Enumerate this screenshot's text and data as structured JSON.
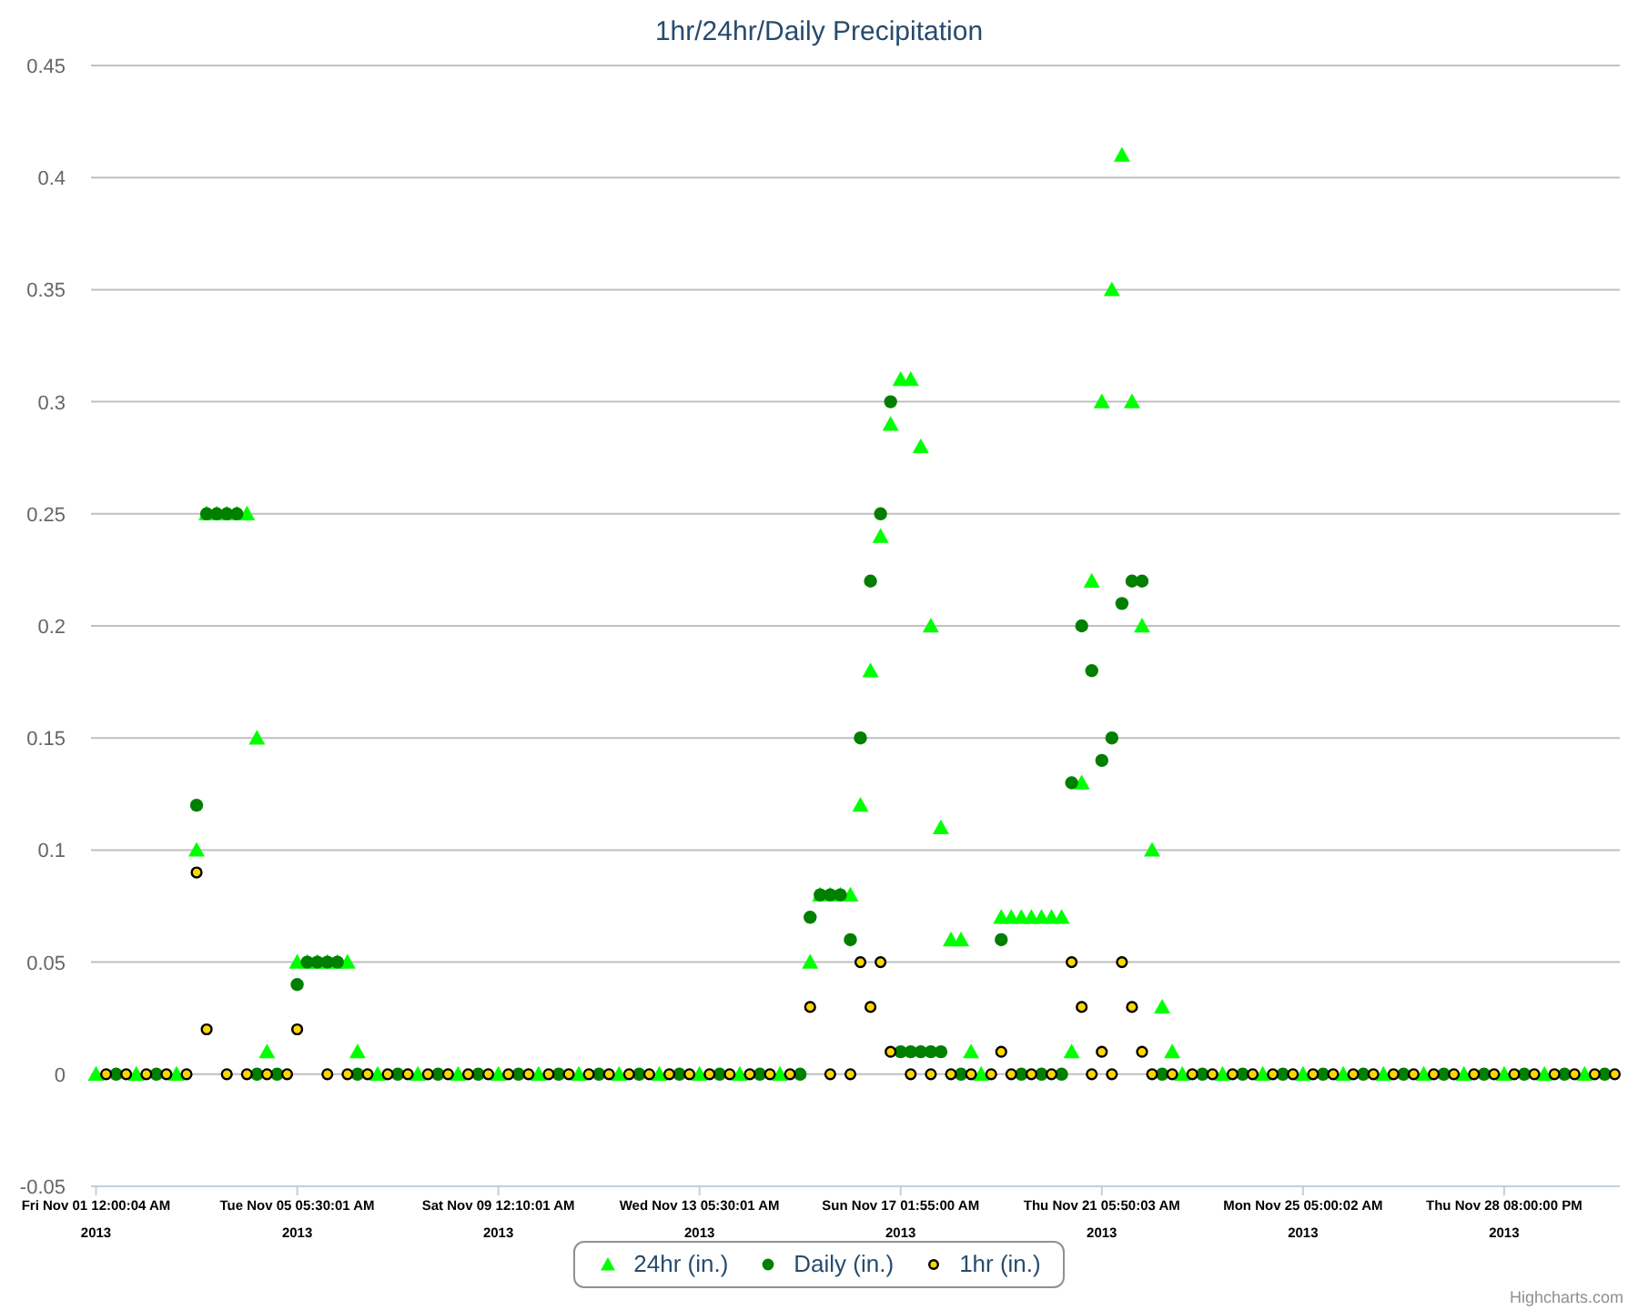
{
  "chart": {
    "chart_data": {
      "type": "scatter",
      "title": "1hr/24hr/Daily Precipitation",
      "grid": true,
      "ylim": [
        -0.05,
        0.45
      ],
      "yticks": [
        -0.05,
        0,
        0.05,
        0.1,
        0.15,
        0.2,
        0.25,
        0.3,
        0.35,
        0.4,
        0.45
      ],
      "categories": [
        "Fri Nov 01 12:00:04 AM\n2013",
        null,
        null,
        null,
        null,
        null,
        null,
        null,
        null,
        null,
        null,
        null,
        null,
        null,
        null,
        null,
        null,
        null,
        null,
        null,
        "Tue Nov 05 05:30:01 AM\n2013",
        null,
        null,
        null,
        null,
        null,
        null,
        null,
        null,
        null,
        null,
        null,
        null,
        null,
        null,
        null,
        null,
        null,
        null,
        null,
        "Sat Nov 09 12:10:01 AM\n2013",
        null,
        null,
        null,
        null,
        null,
        null,
        null,
        null,
        null,
        null,
        null,
        null,
        null,
        null,
        null,
        null,
        null,
        null,
        null,
        "Wed Nov 13 05:30:01 AM\n2013",
        null,
        null,
        null,
        null,
        null,
        null,
        null,
        null,
        null,
        null,
        null,
        null,
        null,
        null,
        null,
        null,
        null,
        null,
        null,
        "Sun Nov 17 01:55:00 AM\n2013",
        null,
        null,
        null,
        null,
        null,
        null,
        null,
        null,
        null,
        null,
        null,
        null,
        null,
        null,
        null,
        null,
        null,
        null,
        null,
        "Thu Nov 21 05:50:03 AM\n2013",
        null,
        null,
        null,
        null,
        null,
        null,
        null,
        null,
        null,
        null,
        null,
        null,
        null,
        null,
        null,
        null,
        null,
        null,
        null,
        "Mon Nov 25 05:00:02 AM\n2013",
        null,
        null,
        null,
        null,
        null,
        null,
        null,
        null,
        null,
        null,
        null,
        null,
        null,
        null,
        null,
        null,
        null,
        null,
        null,
        "Thu Nov 28 08:00:00 PM\n2013",
        null,
        null,
        null,
        null,
        null,
        null,
        null,
        null,
        null,
        null,
        null
      ],
      "series": [
        {
          "name": "24hr (in.)",
          "color": "#00ff00",
          "marker": "triangle",
          "values": [
            0,
            null,
            null,
            null,
            0,
            null,
            null,
            null,
            0,
            null,
            0.1,
            0.25,
            0.25,
            0.25,
            0.25,
            0.25,
            0.15,
            0.01,
            null,
            null,
            0.05,
            0.05,
            0.05,
            0.05,
            0.05,
            0.05,
            0.01,
            null,
            0,
            null,
            null,
            null,
            0,
            null,
            null,
            null,
            0,
            null,
            null,
            null,
            0,
            null,
            null,
            null,
            0,
            null,
            null,
            null,
            0,
            null,
            null,
            null,
            0,
            null,
            null,
            null,
            0,
            null,
            null,
            null,
            0,
            null,
            null,
            null,
            0,
            null,
            null,
            null,
            0,
            null,
            null,
            0.05,
            0.08,
            0.08,
            0.08,
            0.08,
            0.12,
            0.18,
            0.24,
            0.29,
            0.31,
            0.31,
            0.28,
            0.2,
            0.11,
            0.06,
            0.06,
            0.01,
            0,
            null,
            0.07,
            0.07,
            0.07,
            0.07,
            0.07,
            0.07,
            0.07,
            0.01,
            0.13,
            0.22,
            0.3,
            0.35,
            0.41,
            0.3,
            0.2,
            0.1,
            0.03,
            0.01,
            0,
            null,
            null,
            null,
            0,
            null,
            null,
            null,
            0,
            null,
            null,
            null,
            0,
            null,
            null,
            null,
            0,
            null,
            null,
            null,
            0,
            null,
            null,
            null,
            0,
            null,
            null,
            null,
            0,
            null,
            null,
            null,
            0,
            null,
            null,
            null,
            0,
            null,
            null,
            null,
            0,
            null,
            null,
            null
          ]
        },
        {
          "name": "Daily (in.)",
          "color": "#007f00",
          "marker": "circle",
          "values": [
            null,
            null,
            0,
            null,
            null,
            null,
            0,
            null,
            null,
            null,
            0.12,
            0.25,
            0.25,
            0.25,
            0.25,
            null,
            0,
            null,
            0,
            null,
            0.04,
            0.05,
            0.05,
            0.05,
            0.05,
            null,
            0,
            null,
            null,
            null,
            0,
            null,
            null,
            null,
            0,
            null,
            null,
            null,
            0,
            null,
            null,
            null,
            0,
            null,
            null,
            null,
            0,
            null,
            null,
            null,
            0,
            null,
            null,
            null,
            0,
            null,
            null,
            null,
            0,
            null,
            null,
            null,
            0,
            null,
            null,
            null,
            0,
            null,
            null,
            null,
            0,
            0.07,
            0.08,
            0.08,
            0.08,
            0.06,
            0.15,
            0.22,
            0.25,
            0.3,
            0.01,
            0.01,
            0.01,
            0.01,
            0.01,
            null,
            0,
            null,
            null,
            null,
            0.06,
            null,
            0,
            null,
            0,
            null,
            0,
            0.13,
            0.2,
            0.18,
            0.14,
            0.15,
            0.21,
            0.22,
            0.22,
            null,
            0,
            null,
            null,
            null,
            0,
            null,
            null,
            null,
            0,
            null,
            null,
            null,
            0,
            null,
            null,
            null,
            0,
            null,
            null,
            null,
            0,
            null,
            null,
            null,
            0,
            null,
            null,
            null,
            0,
            null,
            null,
            null,
            0,
            null,
            null,
            null,
            0,
            null,
            null,
            null,
            0,
            null,
            null,
            null,
            0,
            null
          ]
        },
        {
          "name": "1hr (in.)",
          "color": "#ffd700",
          "marker": "dot",
          "values": [
            null,
            0,
            null,
            0,
            null,
            0,
            null,
            0,
            null,
            0,
            0.09,
            0.02,
            null,
            0,
            null,
            0,
            null,
            0,
            null,
            0,
            0.02,
            null,
            null,
            0,
            null,
            0,
            null,
            0,
            null,
            0,
            null,
            0,
            null,
            0,
            null,
            0,
            null,
            0,
            null,
            0,
            null,
            0,
            null,
            0,
            null,
            0,
            null,
            0,
            null,
            0,
            null,
            0,
            null,
            0,
            null,
            0,
            null,
            0,
            null,
            0,
            null,
            0,
            null,
            0,
            null,
            0,
            null,
            0,
            null,
            0,
            null,
            0.03,
            null,
            0,
            null,
            0,
            0.05,
            0.03,
            0.05,
            0.01,
            null,
            0,
            null,
            0,
            null,
            0,
            null,
            0,
            null,
            0,
            0.01,
            0,
            null,
            0,
            null,
            0,
            null,
            0.05,
            0.03,
            0,
            0.01,
            0,
            0.05,
            0.03,
            0.01,
            0,
            null,
            0,
            null,
            0,
            null,
            0,
            null,
            0,
            null,
            0,
            null,
            0,
            null,
            0,
            null,
            0,
            null,
            0,
            null,
            0,
            null,
            0,
            null,
            0,
            null,
            0,
            null,
            0,
            null,
            0,
            null,
            0,
            null,
            0,
            null,
            0,
            null,
            0,
            null,
            0,
            null,
            0,
            null,
            0,
            null,
            0
          ]
        }
      ]
    },
    "credit": "Highcharts.com"
  }
}
